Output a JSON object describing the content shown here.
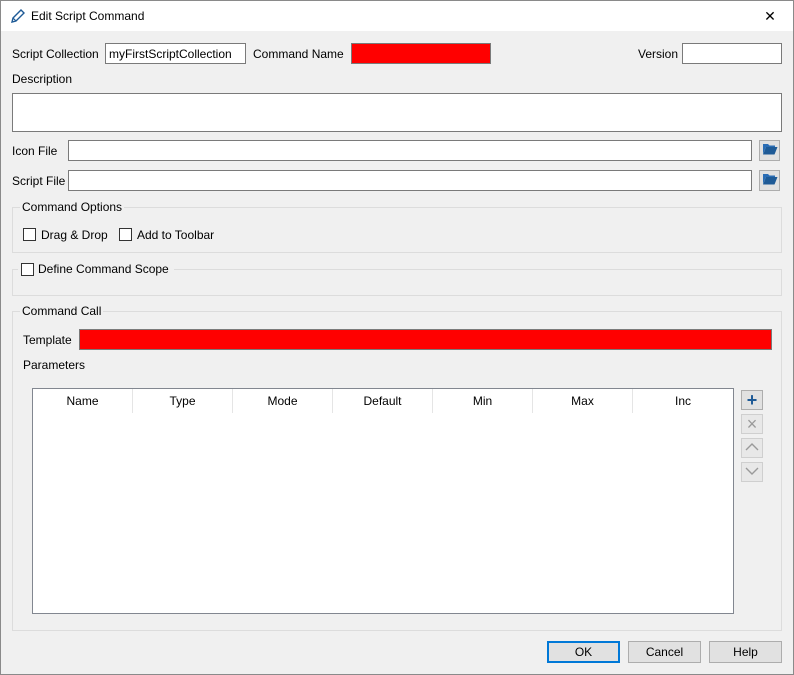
{
  "window": {
    "title": "Edit Script Command",
    "close_glyph": "✕"
  },
  "labels": {
    "script_collection": "Script Collection",
    "command_name": "Command Name",
    "version": "Version",
    "description": "Description",
    "icon_file": "Icon File",
    "script_file": "Script File",
    "template": "Template",
    "parameters": "Parameters"
  },
  "fields": {
    "script_collection": "myFirstScriptCollection",
    "command_name": "",
    "version": "",
    "description": "",
    "icon_file": "",
    "script_file": "",
    "template": ""
  },
  "command_options": {
    "title": "Command Options",
    "drag_drop": {
      "label": "Drag & Drop",
      "checked": false
    },
    "add_to_toolbar": {
      "label": "Add to Toolbar",
      "checked": false
    }
  },
  "scope": {
    "label": "Define Command Scope",
    "checked": false
  },
  "command_call": {
    "title": "Command Call"
  },
  "parameters_table": {
    "columns": [
      "Name",
      "Type",
      "Mode",
      "Default",
      "Min",
      "Max",
      "Inc"
    ],
    "rows": []
  },
  "side_buttons": {
    "add": "+",
    "remove": "×"
  },
  "buttons": {
    "ok": "OK",
    "cancel": "Cancel",
    "help": "Help"
  },
  "colors": {
    "required_field": "#ff0000",
    "accent": "#0078d7",
    "icon_blue": "#1e5a96"
  }
}
